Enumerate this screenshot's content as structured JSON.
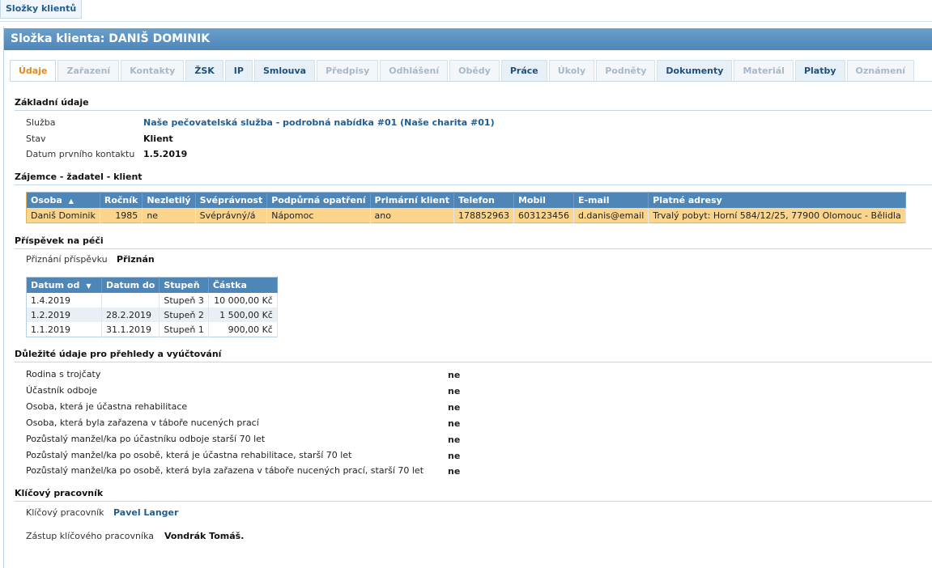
{
  "top_tab": "Složky klientů",
  "title": "Složka klienta: DANIŠ DOMINIK",
  "tabs": [
    "Údaje",
    "Zařazení",
    "Kontakty",
    "ŽSK",
    "IP",
    "Smlouva",
    "Předpisy",
    "Odhlášení",
    "Obědy",
    "Práce",
    "Úkoly",
    "Podněty",
    "Dokumenty",
    "Materiál",
    "Platby",
    "Oznámení"
  ],
  "basic": {
    "heading": "Základní údaje",
    "service_label": "Služba",
    "service_value": "Naše pečovatelská služba - podrobná nabídka #01 (Naše charita #01)",
    "state_label": "Stav",
    "state_value": "Klient",
    "first_contact_label": "Datum prvního kontaktu",
    "first_contact_value": "1.5.2019"
  },
  "applicant": {
    "heading": "Zájemce - žadatel - klient",
    "columns": [
      "Osoba",
      "Ročník",
      "Nezletilý",
      "Svéprávnost",
      "Podpůrná opatření",
      "Primární klient",
      "Telefon",
      "Mobil",
      "E-mail",
      "Platné adresy"
    ],
    "sort_arrow": "▲",
    "row": [
      "Daniš Dominik",
      "1985",
      "ne",
      "Svéprávný/á",
      "Nápomoc",
      "ano",
      "178852963",
      "603123456",
      "d.danis@email",
      "Trvalý pobyt: Horní 584/12/25, 77900 Olomouc - Bělidla"
    ]
  },
  "contribution": {
    "heading": "Příspěvek na péči",
    "granted_label": "Přiznání příspěvku",
    "granted_value": "Přiznán",
    "columns": [
      "Datum od",
      "Datum do",
      "Stupeň",
      "Částka"
    ],
    "sort_arrow": "▼",
    "rows": [
      [
        "1.4.2019",
        "",
        "Stupeň 3",
        "10 000,00 Kč"
      ],
      [
        "1.2.2019",
        "28.2.2019",
        "Stupeň 2",
        "1 500,00 Kč"
      ],
      [
        "1.1.2019",
        "31.1.2019",
        "Stupeň 1",
        "900,00 Kč"
      ]
    ]
  },
  "important": {
    "heading": "Důležité údaje pro přehledy a vyúčtování",
    "items": [
      {
        "label": "Rodina s trojčaty",
        "value": "ne"
      },
      {
        "label": "Účastník odboje",
        "value": "ne"
      },
      {
        "label": "Osoba, která je účastna rehabilitace",
        "value": "ne"
      },
      {
        "label": "Osoba, která byla zařazena v táboře nucených prací",
        "value": "ne"
      },
      {
        "label": "Pozůstalý manžel/ka po účastníku odboje starší 70 let",
        "value": "ne"
      },
      {
        "label": "Pozůstalý manžel/ka po osobě, která je účastna rehabilitace, starší 70 let",
        "value": "ne"
      },
      {
        "label": "Pozůstalý manžel/ka po osobě, která byla zařazena v táboře nucených prací, starší 70 let",
        "value": "ne"
      }
    ]
  },
  "keyworker": {
    "heading": "Klíčový pracovník",
    "label": "Klíčový pracovník",
    "value": "Pavel Langer",
    "deputy_label": "Zástup klíčového pracovníka",
    "deputy_value": "Vondrák Tomáš."
  },
  "colors": {
    "accent": "#4e86b8",
    "active_tab": "#e38a1c",
    "highlight_row": "#fbd58c"
  }
}
